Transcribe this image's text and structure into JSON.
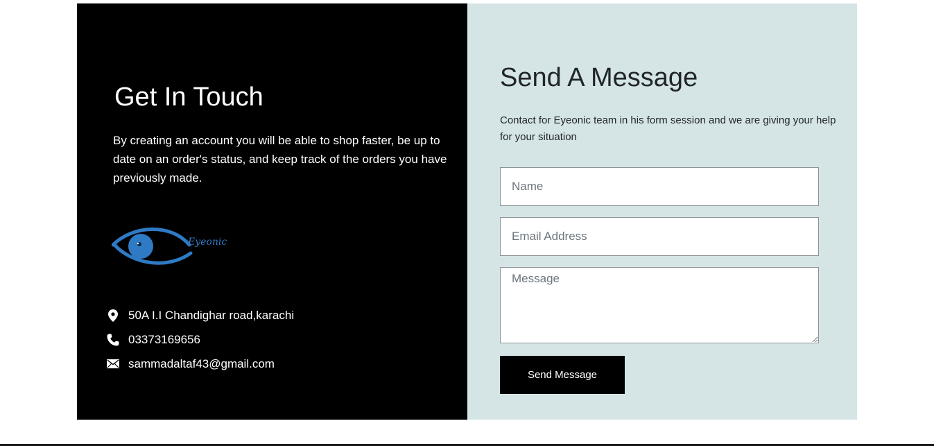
{
  "info": {
    "title": "Get In Touch",
    "text": "By creating an account you will be able to shop faster, be up to date on an order's status, and keep track of the orders you have previously made.",
    "logo": {
      "icon": "eye-logo-icon",
      "wordmark": "Eyeonic",
      "color": "#2f7ac4"
    },
    "contacts": [
      {
        "icon": "location-pin-icon",
        "text": "50A I.I Chandighar road,karachi"
      },
      {
        "icon": "phone-icon",
        "text": "03373169656"
      },
      {
        "icon": "envelope-icon",
        "text": "sammadaltaf43@gmail.com"
      }
    ]
  },
  "form": {
    "title": "Send A Message",
    "text": "Contact for Eyeonic team in his form session and we are giving your help for your situation",
    "name_placeholder": "Name",
    "email_placeholder": "Email Address",
    "message_placeholder": "Message",
    "submit_label": "Send Message"
  },
  "colors": {
    "info_bg": "#000000",
    "form_bg": "#d5e5e6",
    "button_bg": "#000000"
  }
}
